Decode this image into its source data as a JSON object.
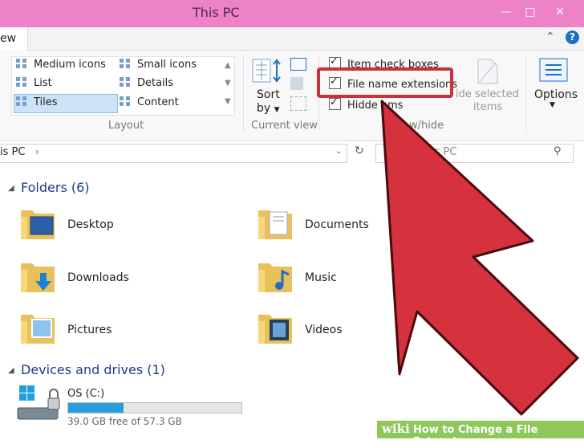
{
  "window": {
    "title": "This PC"
  },
  "ribbon": {
    "tab": "ew",
    "layout": {
      "label": "Layout",
      "items": [
        "Medium icons",
        "Small icons",
        "List",
        "Details",
        "Tiles",
        "Content"
      ],
      "selected": "Tiles"
    },
    "current_view": {
      "label": "Current view",
      "sort_label": "Sort",
      "sort_by": "by"
    },
    "show_hide": {
      "label": "w/hide",
      "item_check_boxes": "Item check boxes",
      "file_name_extensions": "File name extensions",
      "hidden_items": "Hidde     ems",
      "hide_selected": "ide selected",
      "hide_selected_2": "items"
    },
    "options": {
      "label": "Options"
    }
  },
  "address": {
    "path": "is PC",
    "search": "is PC"
  },
  "folders": {
    "header": "Folders (6)",
    "items": [
      {
        "name": "Desktop"
      },
      {
        "name": "Documents"
      },
      {
        "name": "Downloads"
      },
      {
        "name": "Music"
      },
      {
        "name": "Pictures"
      },
      {
        "name": "Videos"
      }
    ]
  },
  "devices": {
    "header": "Devices and drives (1)",
    "drive": {
      "name": "OS (C:)",
      "free": "39.0 GB free of 57.3 GB",
      "used_fraction": 0.32
    }
  },
  "watermark": {
    "brand": "wiki",
    "text": "How to Change a File Extension"
  },
  "colors": {
    "titlebar": "#ee82c8",
    "arrow": "#d6323e",
    "highlight": "#c8323a",
    "drive_fill": "#26a0da"
  }
}
